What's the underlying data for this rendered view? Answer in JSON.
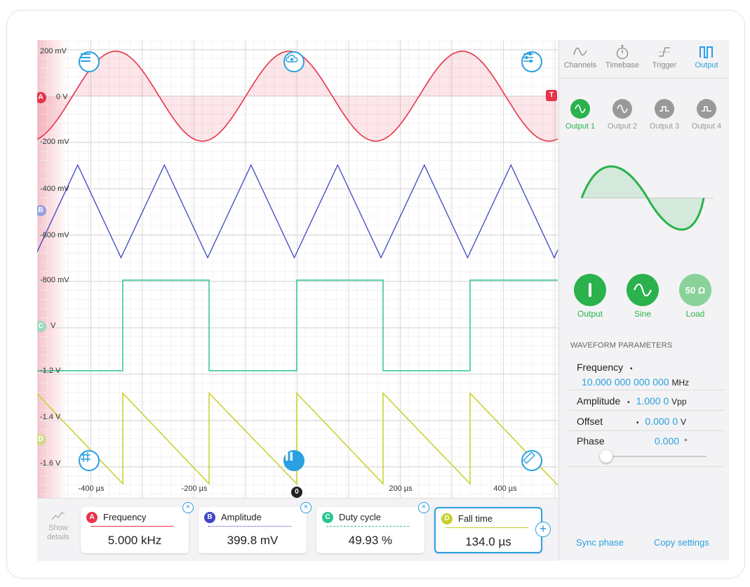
{
  "scope": {
    "y_labels": [
      "200 mV",
      "0 V",
      "-200 mV",
      "-400 mV",
      "-600 mV",
      "-800 mV",
      "V",
      "-1.2 V",
      "-1.4 V",
      "-1.6 V"
    ],
    "x_labels": [
      "-400 µs",
      "-200 µs",
      "200 µs",
      "400 µs"
    ],
    "zero_marker": "0",
    "channel_markers": [
      "A",
      "B",
      "C",
      "D"
    ],
    "trigger_marker": "T",
    "colors": {
      "A": "#e8334a",
      "B": "#3b45c4",
      "C": "#2cc58e",
      "D": "#c9cf2a",
      "accent": "#2aa0e0",
      "green": "#2bb24c"
    },
    "icons": [
      "menu-icon",
      "cloud-upload-icon",
      "sliders-icon",
      "grid-icon",
      "pause-icon",
      "ruler-icon"
    ]
  },
  "measurements": {
    "show_details": "Show details",
    "cards": [
      {
        "channel": "A",
        "label": "Frequency",
        "value": "5.000 kHz"
      },
      {
        "channel": "B",
        "label": "Amplitude",
        "value": "399.8 mV"
      },
      {
        "channel": "C",
        "label": "Duty cycle",
        "value": "49.93 %"
      },
      {
        "channel": "D",
        "label": "Fall time",
        "value": "134.0 µs"
      }
    ],
    "close_symbol": "×",
    "add_symbol": "+"
  },
  "panel": {
    "tabs": [
      "Channels",
      "Timebase",
      "Trigger",
      "Output"
    ],
    "active_tab": "Output",
    "outputs": [
      "Output 1",
      "Output 2",
      "Output 3",
      "Output 4"
    ],
    "active_output": "Output 1",
    "controls": {
      "output": "Output",
      "sine": "Sine",
      "load": "Load",
      "load_value": "50 Ω"
    },
    "waveform_header": "WAVEFORM PARAMETERS",
    "params": {
      "frequency_label": "Frequency",
      "frequency_value": "10.000 000 000 000",
      "frequency_unit": "MHz",
      "amplitude_label": "Amplitude",
      "amplitude_value": "1.000 0",
      "amplitude_unit": "Vpp",
      "offset_label": "Offset",
      "offset_value": "0.000 0",
      "offset_unit": "V",
      "phase_label": "Phase",
      "phase_value": "0.000",
      "phase_unit": "°",
      "dot": "•"
    },
    "sync_phase": "Sync phase",
    "copy_settings": "Copy settings"
  }
}
